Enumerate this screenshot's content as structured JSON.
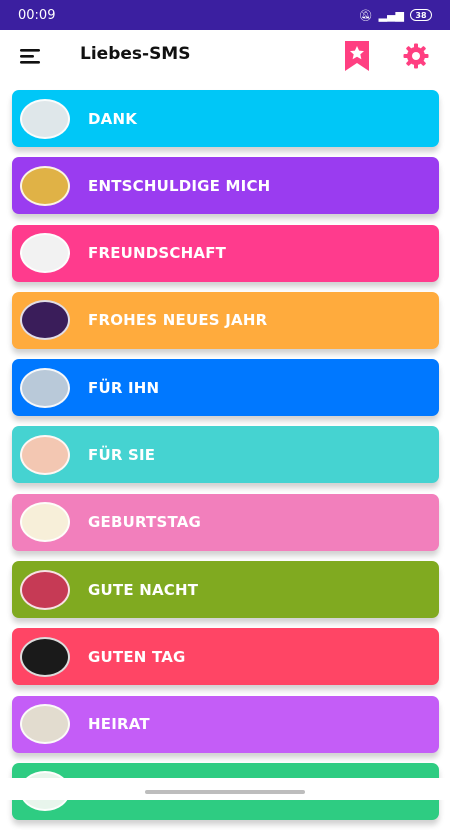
{
  "status_bar": {
    "time": "00:09",
    "battery": "38"
  },
  "app_bar": {
    "title": "Liebes-SMS",
    "icons": [
      "menu-icon",
      "bookmark-star-icon",
      "gear-icon"
    ],
    "accent_color": "#ff3f81"
  },
  "categories": [
    {
      "label": "DANK",
      "color": "#00c7f7",
      "avatar_color": "#dfe7ea"
    },
    {
      "label": "ENTSCHULDIGE MICH",
      "color": "#9a3cf0",
      "avatar_color": "#e0b246"
    },
    {
      "label": "FREUNDSCHAFT",
      "color": "#ff3b8d",
      "avatar_color": "#f2f2f2"
    },
    {
      "label": "FROHES NEUES JAHR",
      "color": "#ffab3d",
      "avatar_color": "#3a1d5a"
    },
    {
      "label": "FÜR IHN",
      "color": "#0078ff",
      "avatar_color": "#b9c9d9"
    },
    {
      "label": "FÜR SIE",
      "color": "#45d3d1",
      "avatar_color": "#f3c7b2"
    },
    {
      "label": "GEBURTSTAG",
      "color": "#f27fbc",
      "avatar_color": "#f7efd9"
    },
    {
      "label": "GUTE NACHT",
      "color": "#80aa20",
      "avatar_color": "#c63a55"
    },
    {
      "label": "GUTEN TAG",
      "color": "#ff4565",
      "avatar_color": "#1a1a1a"
    },
    {
      "label": "HEIRAT",
      "color": "#c45df7",
      "avatar_color": "#e2dccf"
    },
    {
      "label": "",
      "color": "#2ecc82",
      "avatar_color": "#e8f5ec"
    }
  ]
}
